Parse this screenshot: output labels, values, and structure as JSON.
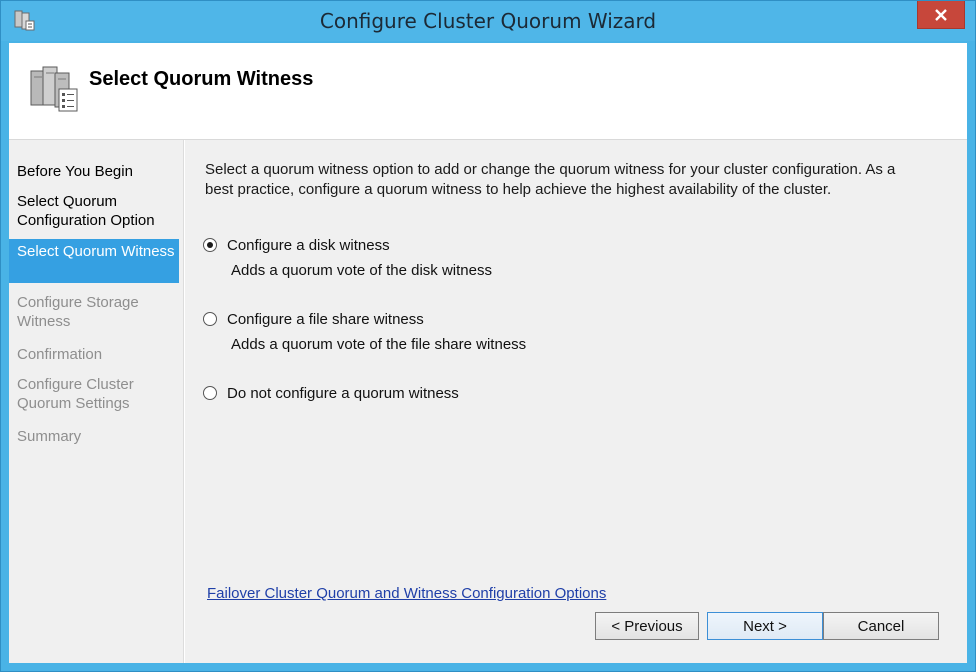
{
  "window": {
    "title": "Configure Cluster Quorum Wizard"
  },
  "header": {
    "title": "Select Quorum Witness"
  },
  "sidebar": {
    "items": [
      {
        "label": "Before You Begin",
        "state": "normal"
      },
      {
        "label": "Select Quorum Configuration Option",
        "state": "normal"
      },
      {
        "label": "Select Quorum Witness",
        "state": "active"
      },
      {
        "label": "Configure Storage Witness",
        "state": "disabled"
      },
      {
        "label": "Confirmation",
        "state": "disabled"
      },
      {
        "label": "Configure Cluster Quorum Settings",
        "state": "disabled"
      },
      {
        "label": "Summary",
        "state": "disabled"
      }
    ]
  },
  "main": {
    "intro": "Select a quorum witness option to add or change the quorum witness for your cluster configuration. As a best practice, configure a quorum witness to help achieve the highest availability of the cluster.",
    "options": [
      {
        "label": "Configure a disk witness",
        "description": "Adds a quorum vote of the disk witness",
        "checked": true
      },
      {
        "label": "Configure a file share witness",
        "description": "Adds a quorum vote of the file share witness",
        "checked": false
      },
      {
        "label": "Do not configure a quorum witness",
        "description": "",
        "checked": false
      }
    ],
    "link": "Failover Cluster Quorum and Witness Configuration Options"
  },
  "buttons": {
    "previous": "< Previous",
    "next": "Next >",
    "cancel": "Cancel"
  },
  "colors": {
    "window_frame": "#4fb6e8",
    "close_button": "#c7473b",
    "active_nav": "#35a0e2",
    "link": "#1f3fa8"
  }
}
